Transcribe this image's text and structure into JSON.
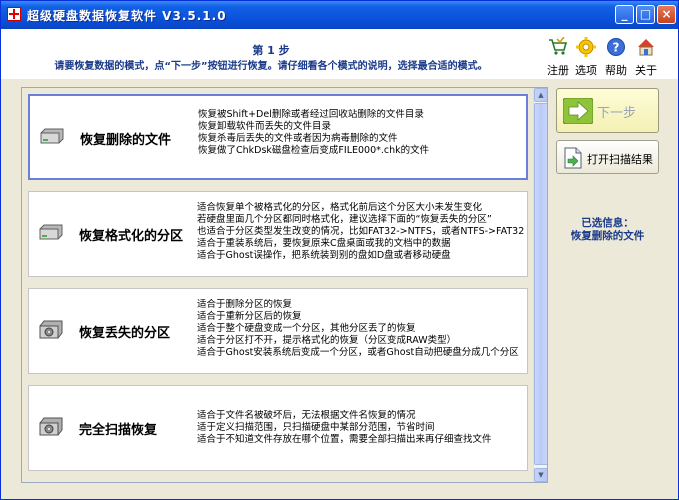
{
  "window": {
    "title": "超级硬盘数据恢复软件 V3.5.1.0",
    "controls": {
      "minimize": "_",
      "maximize": "□",
      "close": "×"
    }
  },
  "header": {
    "step_title": "第 1 步",
    "step_desc": "请要恢复数据的模式，点“下一步”按钮进行恢复。请仔细看各个模式的说明，选择最合适的模式。",
    "buttons": [
      {
        "label": "注册",
        "icon": "cart-icon"
      },
      {
        "label": "选项",
        "icon": "gear-icon"
      },
      {
        "label": "帮助",
        "icon": "help-icon"
      },
      {
        "label": "关于",
        "icon": "home-icon"
      }
    ]
  },
  "modes": [
    {
      "title": "恢复删除的文件",
      "desc": [
        "恢复被Shift+Del删除或者经过回收站删除的文件目录",
        "恢复卸载软件而丢失的文件目录",
        "恢复杀毒后丢失的文件或者因为病毒删除的文件",
        "恢复做了ChkDsk磁盘检查后变成FILE000*.chk的文件"
      ]
    },
    {
      "title": "恢复格式化的分区",
      "desc": [
        "适合恢复单个被格式化的分区，格式化前后这个分区大小未发生变化",
        "若硬盘里面几个分区都同时格式化，建议选择下面的“恢复丢失的分区”",
        "也适合于分区类型发生改变的情况，比如FAT32->NTFS，或者NTFS->FAT32",
        "适合于重装系统后，要恢复原来C盘桌面或我的文档中的数据",
        "适合于Ghost误操作，把系统装到别的盘如D盘或者移动硬盘"
      ]
    },
    {
      "title": "恢复丢失的分区",
      "desc": [
        "适合于删除分区的恢复",
        "适合于重新分区后的恢复",
        "适合于整个硬盘变成一个分区，其他分区丢了的恢复",
        "适合于分区打不开，提示格式化的恢复（分区变成RAW类型）",
        "适合于Ghost安装系统后变成一个分区，或者Ghost自动把硬盘分成几个分区"
      ]
    },
    {
      "title": "完全扫描恢复",
      "desc": [
        "适合于文件名被破坏后，无法根据文件名恢复的情况",
        "适于定义扫描范围，只扫描硬盘中某部分范围，节省时间",
        "适合于不知道文件存放在哪个位置，需要全部扫描出来再仔细查找文件"
      ]
    }
  ],
  "scrollbar": {
    "up": "▲",
    "down": "▼"
  },
  "actions": {
    "next_label": "下一步",
    "open_scan_label": "打开扫描结果"
  },
  "selected_info": {
    "label": "已选信息：",
    "value": "恢复删除的文件"
  }
}
